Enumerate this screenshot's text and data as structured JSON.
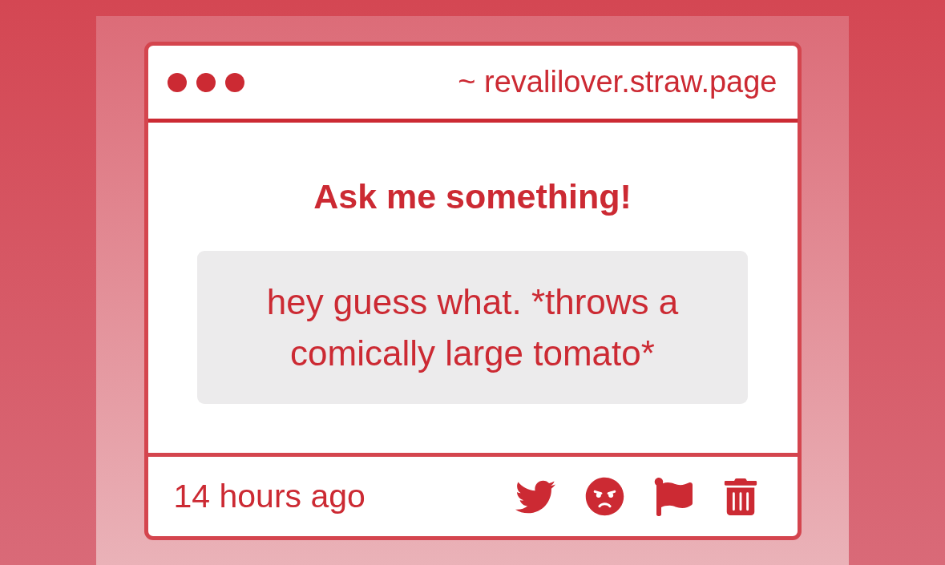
{
  "window": {
    "url": "~ revalilover.straw.page"
  },
  "prompt": {
    "title": "Ask me something!"
  },
  "question": {
    "text": "hey guess what. *throws a comically large tomato*"
  },
  "footer": {
    "timestamp": "14 hours ago"
  }
}
